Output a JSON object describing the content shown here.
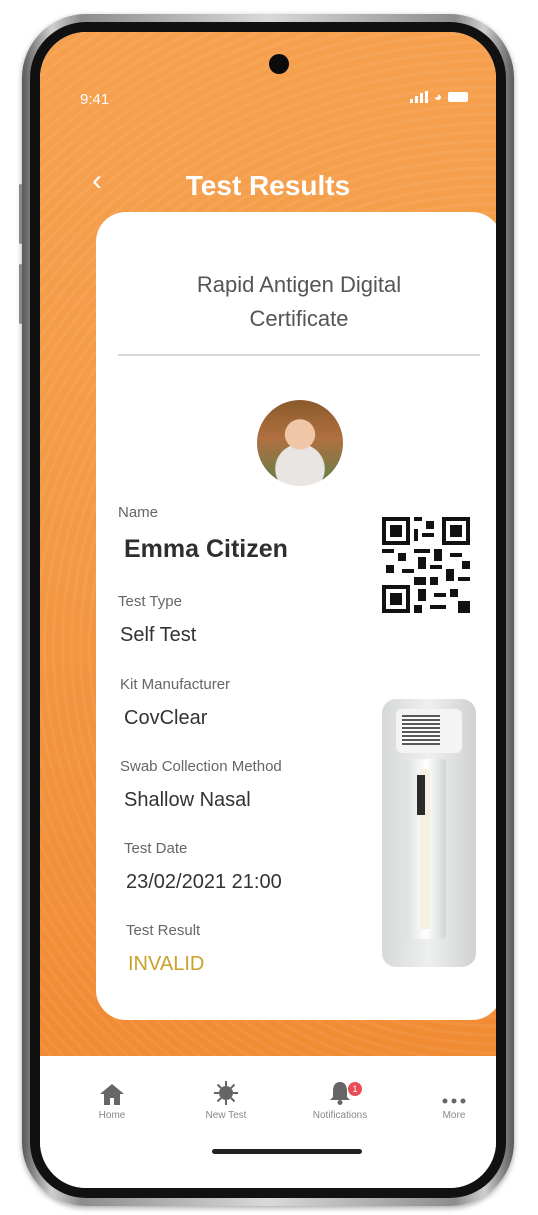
{
  "status_bar": {
    "time": "9:41"
  },
  "header": {
    "back_icon": "chevron-left-icon",
    "title": "Test Results"
  },
  "certificate": {
    "title": "Rapid Antigen Digital Certificate",
    "fields": {
      "name": {
        "label": "Name",
        "value": "Emma Citizen"
      },
      "test_type": {
        "label": "Test Type",
        "value": "Self Test"
      },
      "kit_manufacturer": {
        "label": "Kit Manufacturer",
        "value": "CovClear"
      },
      "swab_method": {
        "label": "Swab Collection Method",
        "value": "Shallow Nasal"
      },
      "test_date": {
        "label": "Test Date",
        "value": "23/02/2021 21:00"
      },
      "test_result": {
        "label": "Test Result",
        "value": "INVALID",
        "color": "#c9a12b"
      }
    }
  },
  "tabbar": {
    "items": [
      {
        "label": "Home",
        "icon": "home-icon"
      },
      {
        "label": "New Test",
        "icon": "virus-icon"
      },
      {
        "label": "Notifications",
        "icon": "bell-icon",
        "badge": "1"
      },
      {
        "label": "More",
        "icon": "more-icon"
      }
    ]
  },
  "colors": {
    "accent": "#f39a45",
    "badge": "#ea4c57"
  }
}
